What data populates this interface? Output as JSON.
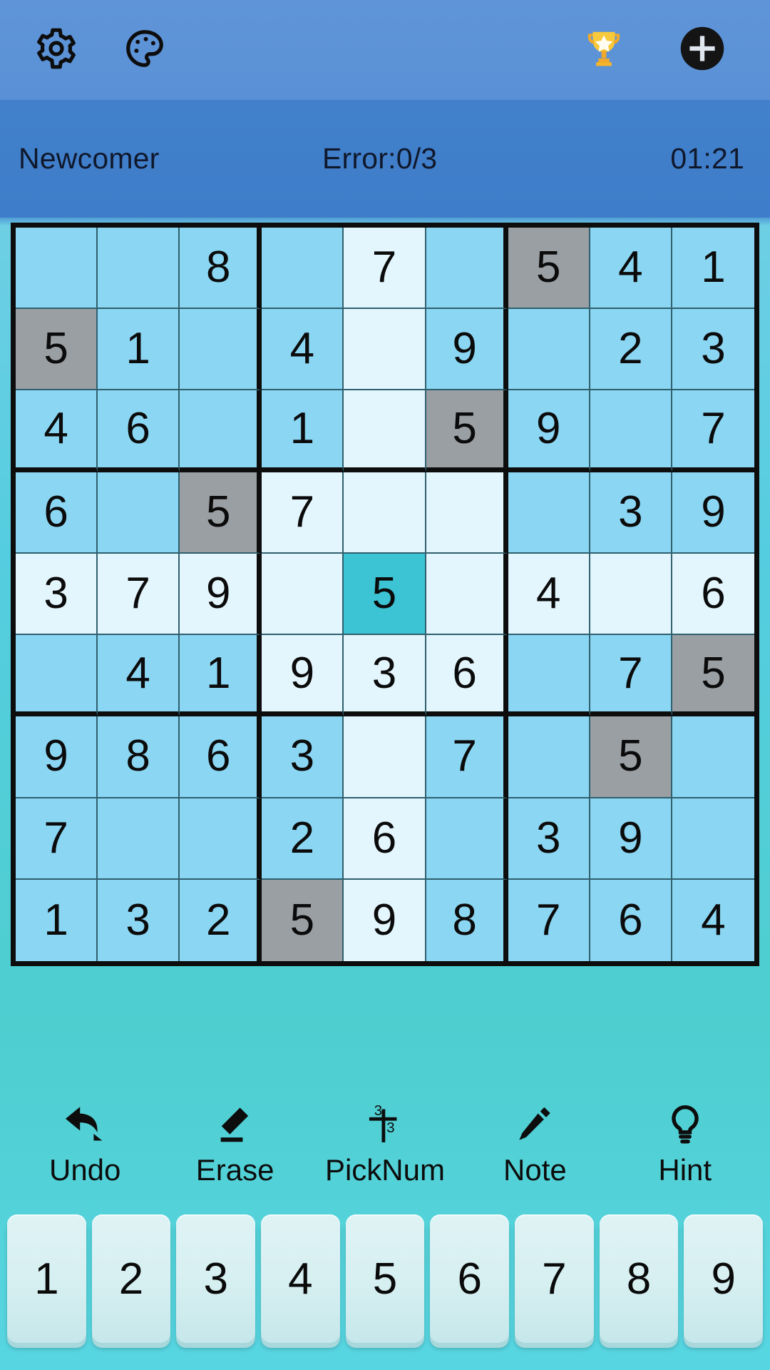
{
  "topbar": {
    "settings_icon": "gear-icon",
    "theme_icon": "palette-icon",
    "trophy_icon": "trophy-icon",
    "add_icon": "plus-circle-icon"
  },
  "status": {
    "difficulty": "Newcomer",
    "errors": "Error:0/3",
    "timer": "01:21"
  },
  "colors": {
    "cell_base": "#8bd6f2",
    "cell_highlight": "#e4f6fd",
    "cell_peer_gray": "#9a9fa3",
    "cell_selected": "#3cc3d4",
    "grid_line": "#0d0d0d",
    "header_blue": "#5a90d5",
    "status_blue": "#3e7dc9",
    "board_bg_cyan": "#55cde0",
    "trophy_gold": "#f5b51e"
  },
  "board": {
    "selected": {
      "row": 5,
      "col": 5,
      "value": "5"
    },
    "rows": [
      [
        {
          "v": "",
          "s": "base"
        },
        {
          "v": "",
          "s": "base"
        },
        {
          "v": "8",
          "s": "base"
        },
        {
          "v": "",
          "s": "base"
        },
        {
          "v": "7",
          "s": "light"
        },
        {
          "v": "",
          "s": "base"
        },
        {
          "v": "5",
          "s": "gray"
        },
        {
          "v": "4",
          "s": "base"
        },
        {
          "v": "1",
          "s": "base"
        }
      ],
      [
        {
          "v": "5",
          "s": "gray"
        },
        {
          "v": "1",
          "s": "base"
        },
        {
          "v": "",
          "s": "base"
        },
        {
          "v": "4",
          "s": "base"
        },
        {
          "v": "",
          "s": "light"
        },
        {
          "v": "9",
          "s": "base"
        },
        {
          "v": "",
          "s": "base"
        },
        {
          "v": "2",
          "s": "base"
        },
        {
          "v": "3",
          "s": "base"
        }
      ],
      [
        {
          "v": "4",
          "s": "base"
        },
        {
          "v": "6",
          "s": "base"
        },
        {
          "v": "",
          "s": "base"
        },
        {
          "v": "1",
          "s": "base"
        },
        {
          "v": "",
          "s": "light"
        },
        {
          "v": "5",
          "s": "gray"
        },
        {
          "v": "9",
          "s": "base"
        },
        {
          "v": "",
          "s": "base"
        },
        {
          "v": "7",
          "s": "base"
        }
      ],
      [
        {
          "v": "6",
          "s": "base"
        },
        {
          "v": "",
          "s": "base"
        },
        {
          "v": "5",
          "s": "gray"
        },
        {
          "v": "7",
          "s": "light"
        },
        {
          "v": "",
          "s": "light"
        },
        {
          "v": "",
          "s": "light"
        },
        {
          "v": "",
          "s": "base"
        },
        {
          "v": "3",
          "s": "base"
        },
        {
          "v": "9",
          "s": "base"
        }
      ],
      [
        {
          "v": "3",
          "s": "light"
        },
        {
          "v": "7",
          "s": "light"
        },
        {
          "v": "9",
          "s": "light"
        },
        {
          "v": "",
          "s": "light"
        },
        {
          "v": "5",
          "s": "sel"
        },
        {
          "v": "",
          "s": "light"
        },
        {
          "v": "4",
          "s": "light"
        },
        {
          "v": "",
          "s": "light"
        },
        {
          "v": "6",
          "s": "light"
        }
      ],
      [
        {
          "v": "",
          "s": "base"
        },
        {
          "v": "4",
          "s": "base"
        },
        {
          "v": "1",
          "s": "base"
        },
        {
          "v": "9",
          "s": "light"
        },
        {
          "v": "3",
          "s": "light"
        },
        {
          "v": "6",
          "s": "light"
        },
        {
          "v": "",
          "s": "base"
        },
        {
          "v": "7",
          "s": "base"
        },
        {
          "v": "5",
          "s": "gray"
        }
      ],
      [
        {
          "v": "9",
          "s": "base"
        },
        {
          "v": "8",
          "s": "base"
        },
        {
          "v": "6",
          "s": "base"
        },
        {
          "v": "3",
          "s": "base"
        },
        {
          "v": "",
          "s": "light"
        },
        {
          "v": "7",
          "s": "base"
        },
        {
          "v": "",
          "s": "base"
        },
        {
          "v": "5",
          "s": "gray"
        },
        {
          "v": "",
          "s": "base"
        }
      ],
      [
        {
          "v": "7",
          "s": "base"
        },
        {
          "v": "",
          "s": "base"
        },
        {
          "v": "",
          "s": "base"
        },
        {
          "v": "2",
          "s": "base"
        },
        {
          "v": "6",
          "s": "light"
        },
        {
          "v": "",
          "s": "base"
        },
        {
          "v": "3",
          "s": "base"
        },
        {
          "v": "9",
          "s": "base"
        },
        {
          "v": "",
          "s": "base"
        }
      ],
      [
        {
          "v": "1",
          "s": "base"
        },
        {
          "v": "3",
          "s": "base"
        },
        {
          "v": "2",
          "s": "base"
        },
        {
          "v": "5",
          "s": "gray"
        },
        {
          "v": "9",
          "s": "light"
        },
        {
          "v": "8",
          "s": "base"
        },
        {
          "v": "7",
          "s": "base"
        },
        {
          "v": "6",
          "s": "base"
        },
        {
          "v": "4",
          "s": "base"
        }
      ]
    ]
  },
  "tools": [
    {
      "label": "Undo",
      "icon": "undo-arrow-icon"
    },
    {
      "label": "Erase",
      "icon": "eraser-icon"
    },
    {
      "label": "PickNum",
      "icon": "picknum-icon",
      "icon_top": "3",
      "icon_bottom": "3"
    },
    {
      "label": "Note",
      "icon": "pencil-icon"
    },
    {
      "label": "Hint",
      "icon": "lightbulb-icon"
    }
  ],
  "numpad": [
    "1",
    "2",
    "3",
    "4",
    "5",
    "6",
    "7",
    "8",
    "9"
  ]
}
